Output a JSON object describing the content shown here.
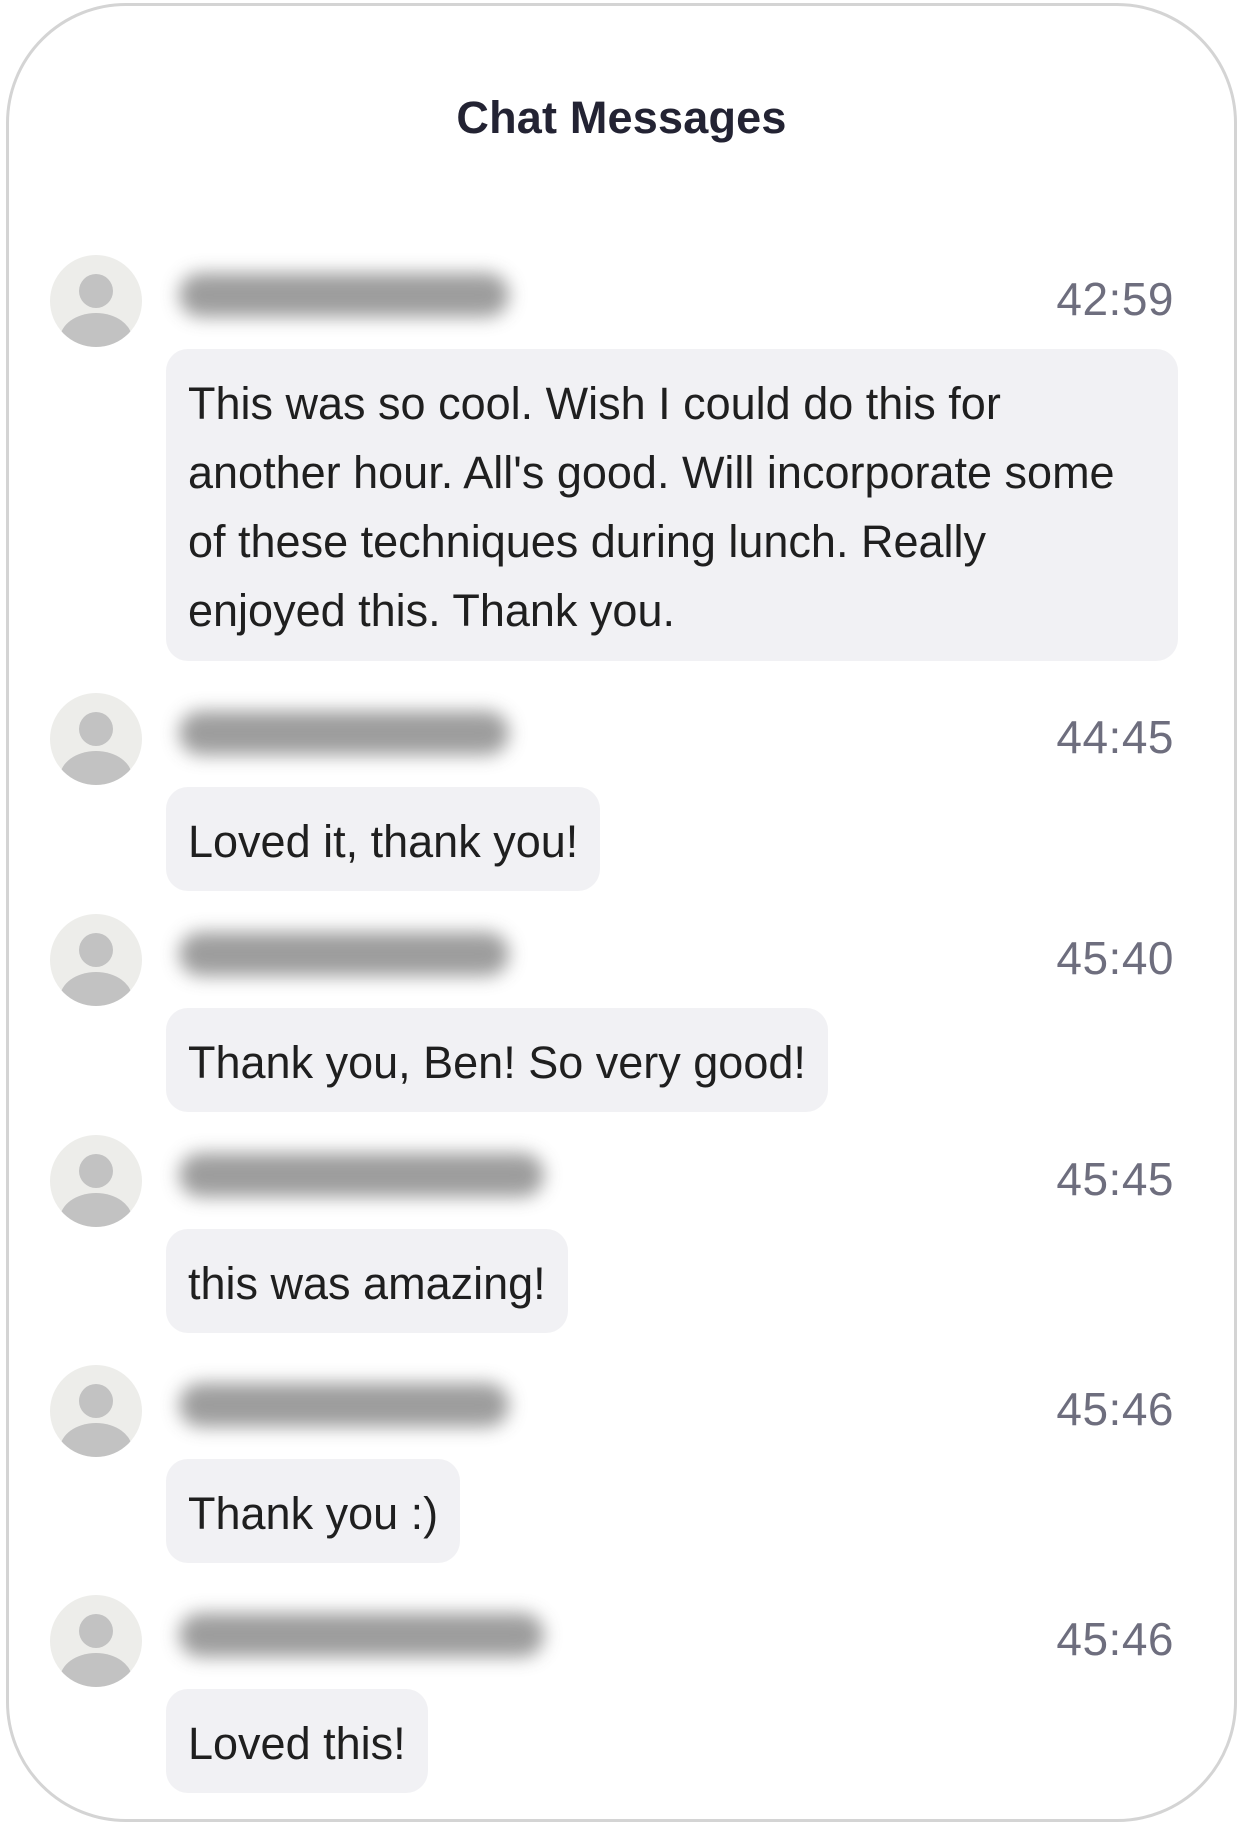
{
  "header": {
    "title": "Chat Messages"
  },
  "messages": [
    {
      "sender": "",
      "time": "42:59",
      "text": "This was so cool. Wish I could do this for another hour. All's good. Will incorporate some of these techniques during lunch. Really enjoyed this. Thank you."
    },
    {
      "sender": "",
      "time": "44:45",
      "text": "Loved it, thank you!"
    },
    {
      "sender": "",
      "time": "45:40",
      "text": "Thank you, Ben! So very good!"
    },
    {
      "sender": "",
      "time": "45:45",
      "text": "this was amazing!"
    },
    {
      "sender": "",
      "time": "45:46",
      "text": "Thank you :)"
    },
    {
      "sender": "",
      "time": "45:46",
      "text": "Loved this!"
    }
  ],
  "icons": {
    "avatar": "default-user-icon"
  },
  "colors": {
    "bubble": "#f1f1f4",
    "title": "#232333",
    "time": "#6e6e7e",
    "avatar_bg": "#ededea",
    "avatar_fg": "#c2c2c2"
  }
}
